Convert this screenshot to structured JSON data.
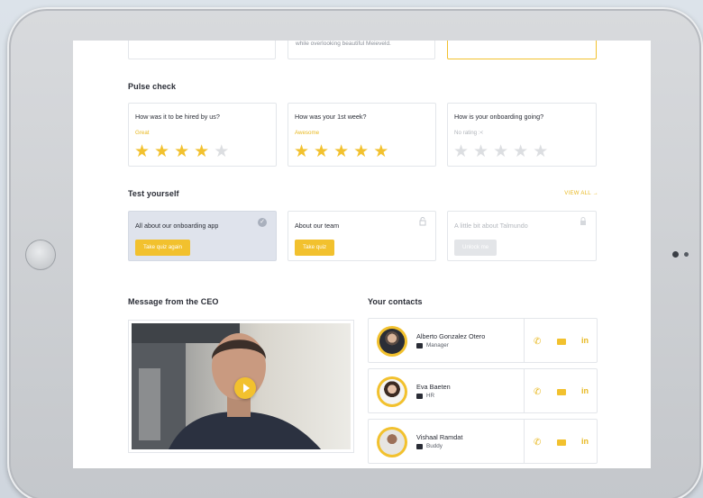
{
  "top_cards": {
    "middle_text": "while overlooking beautiful Meieveld."
  },
  "pulse": {
    "title": "Pulse check",
    "items": [
      {
        "question": "How was it to be hired by us?",
        "rating_label": "Great",
        "stars": 4
      },
      {
        "question": "How was your 1st week?",
        "rating_label": "Awesome",
        "stars": 5
      },
      {
        "question": "How is your onboarding going?",
        "rating_label": "No rating :<",
        "stars": 0
      }
    ]
  },
  "quiz": {
    "title": "Test yourself",
    "view_all": "VIEW ALL",
    "items": [
      {
        "title": "All about our onboarding app",
        "button": "Take quiz again",
        "state": "completed"
      },
      {
        "title": "About our team",
        "button": "Take quiz",
        "state": "unlocked"
      },
      {
        "title": "A little bit about Talmundo",
        "button": "Unlock me",
        "state": "locked"
      }
    ]
  },
  "ceo": {
    "title": "Message from the CEO"
  },
  "contacts": {
    "title": "Your contacts",
    "items": [
      {
        "name": "Alberto Gonzalez Otero",
        "role": "Manager"
      },
      {
        "name": "Eva Baeten",
        "role": "HR"
      },
      {
        "name": "Vishaal Ramdat",
        "role": "Buddy"
      }
    ],
    "linkedin_label": "in"
  },
  "colors": {
    "accent": "#f2c12e",
    "completed_bg": "#dfe3ec"
  }
}
